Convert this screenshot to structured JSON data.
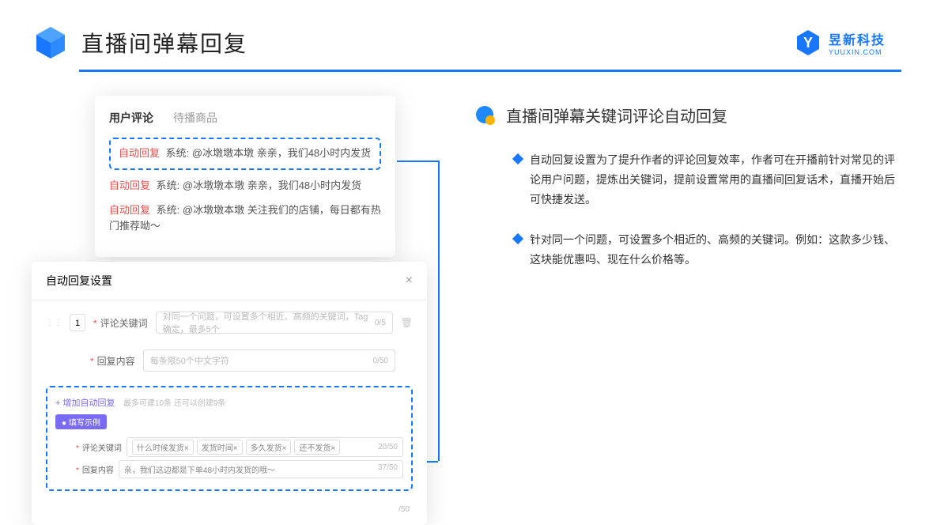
{
  "header": {
    "title": "直播间弹幕回复",
    "brand_cn": "昱新科技",
    "brand_en": "YUUXIN.COM"
  },
  "card1": {
    "tab_active": "用户评论",
    "tab_inactive": "待播商品",
    "reply_tag": "自动回复",
    "system_label": "系统:",
    "comment1": "@冰墩墩本墩 亲亲，我们48小时内发货",
    "comment2": "@冰墩墩本墩 亲亲，我们48小时内发货",
    "comment3": "@冰墩墩本墩 关注我们的店铺，每日都有热门推荐呦～"
  },
  "card2": {
    "title": "自动回复设置",
    "row_num": "1",
    "keyword_label": "评论关键词",
    "keyword_placeholder": "对同一个问题，可设置多个相近、高频的关键词，Tag确定，最多5个",
    "keyword_counter": "0/5",
    "content_label": "回复内容",
    "content_placeholder": "每条限50个中文字符",
    "content_counter": "0/50",
    "add_link": "+ 增加自动回复",
    "add_hint": "最多可建10条 还可以创建9条",
    "example_badge": "● 填写示例",
    "ex_keyword_label": "评论关键词",
    "ex_tags": [
      "什么时候发货×",
      "发货时间×",
      "多久发货×",
      "还不发货×"
    ],
    "ex_kw_counter": "20/50",
    "ex_content_label": "回复内容",
    "ex_content_value": "亲，我们这边都是下单48小时内发货的哦～",
    "ex_content_counter": "37/50",
    "outer_counter": "/50"
  },
  "right": {
    "heading": "直播间弹幕关键词评论自动回复",
    "bullet1": "自动回复设置为了提升作者的评论回复效率，作者可在开播前针对常见的评论用户问题，提炼出关键词，提前设置常用的直播间回复话术，直播开始后可快捷发送。",
    "bullet2": "针对同一个问题，可设置多个相近的、高频的关键词。例如：这款多少钱、这块能优惠吗、现在什么价格等。"
  }
}
